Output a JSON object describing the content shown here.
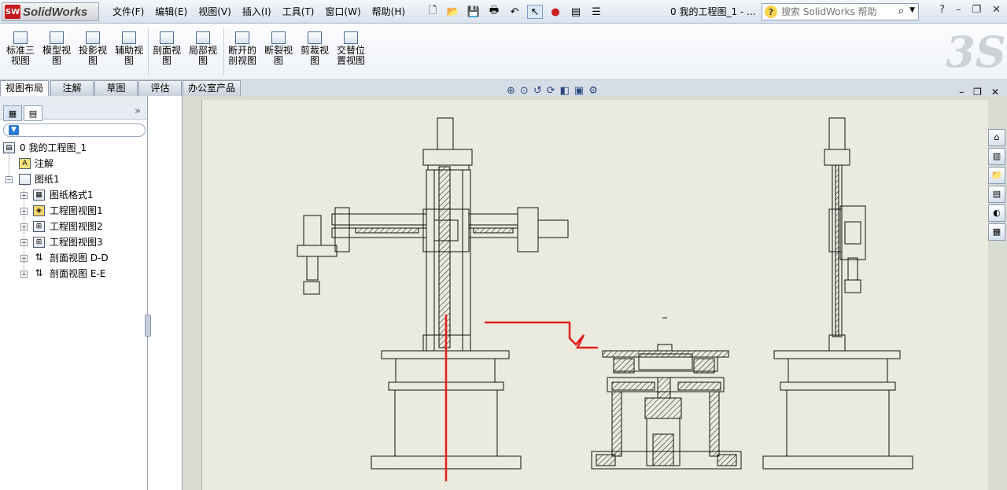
{
  "app": {
    "name": "SolidWorks",
    "badge": "SW"
  },
  "menu": [
    "文件(F)",
    "编辑(E)",
    "视图(V)",
    "插入(I)",
    "工具(T)",
    "窗口(W)",
    "帮助(H)"
  ],
  "document_title": "0 我的工程图_1 - ...",
  "search": {
    "placeholder": "搜索 SolidWorks 帮助"
  },
  "ribbon_buttons": [
    {
      "label": "标准三视图",
      "icon": "standard-3-view-icon"
    },
    {
      "label": "模型视图",
      "icon": "model-view-icon"
    },
    {
      "label": "投影视图",
      "icon": "projected-view-icon"
    },
    {
      "label": "辅助视图",
      "icon": "auxiliary-view-icon"
    },
    {
      "label": "剖面视图",
      "icon": "section-view-icon"
    },
    {
      "label": "局部视图",
      "icon": "detail-view-icon"
    },
    {
      "label": "断开的剖视图",
      "icon": "broken-out-section-icon"
    },
    {
      "label": "断裂视图",
      "icon": "break-view-icon"
    },
    {
      "label": "剪裁视图",
      "icon": "crop-view-icon"
    },
    {
      "label": "交替位置视图",
      "icon": "alternate-position-view-icon"
    }
  ],
  "tabs": [
    "视图布局",
    "注解",
    "草图",
    "评估",
    "办公室产品"
  ],
  "active_tab": "视图布局",
  "tree": {
    "root": "0 我的工程图_1",
    "items": [
      {
        "label": "注解",
        "level": 1,
        "expander": "",
        "icon": "annotation-icon"
      },
      {
        "label": "图纸1",
        "level": 1,
        "expander": "−",
        "icon": "sheet-icon"
      },
      {
        "label": "图纸格式1",
        "level": 2,
        "expander": "+",
        "icon": "sheet-format-icon"
      },
      {
        "label": "工程图视图1",
        "level": 2,
        "expander": "+",
        "icon": "drawing-view-icon"
      },
      {
        "label": "工程图视图2",
        "level": 2,
        "expander": "+",
        "icon": "drawing-view-icon"
      },
      {
        "label": "工程图视图3",
        "level": 2,
        "expander": "+",
        "icon": "drawing-view-icon"
      },
      {
        "label": "剖面视图 D-D",
        "level": 2,
        "expander": "+",
        "icon": "section-view-icon"
      },
      {
        "label": "剖面视图 E-E",
        "level": 2,
        "expander": "+",
        "icon": "section-view-icon"
      }
    ]
  },
  "colors": {
    "sheet_bg": "#eaeadf",
    "annotation_red": "#e0201c",
    "ribbon_bg": "#eef2f7"
  },
  "view_toolbar": [
    "zoom-to-fit-icon",
    "zoom-to-area-icon",
    "previous-view-icon",
    "rebuild-icon",
    "view-display-icon",
    "hide-show-icon"
  ]
}
